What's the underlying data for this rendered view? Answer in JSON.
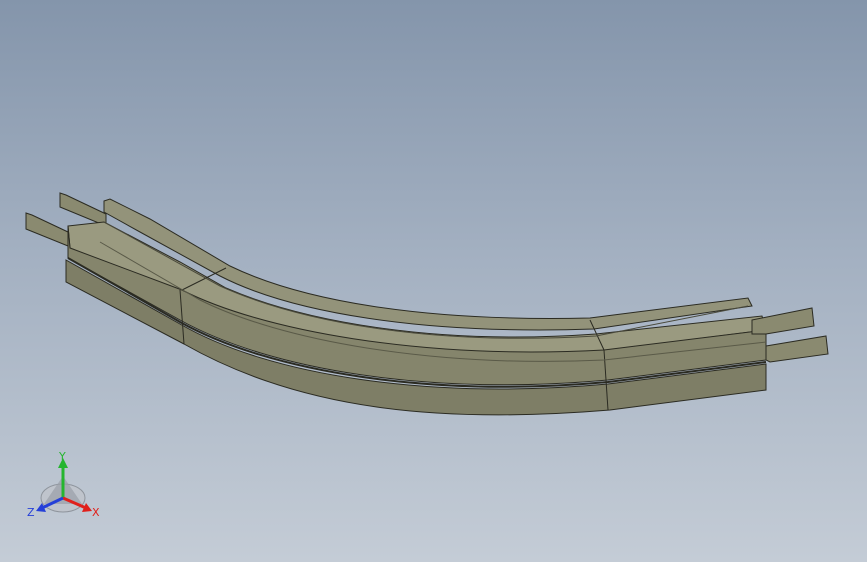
{
  "viewport": {
    "background_top": "#8495ab",
    "background_bottom": "#c4ccd6"
  },
  "model": {
    "description_color": "#8b8b72",
    "face_top": "#9a9a80",
    "face_front": "#85856c",
    "face_dark": "#6f6f5a",
    "edge": "#2b2b22"
  },
  "triad": {
    "x_label": "X",
    "y_label": "Y",
    "z_label": "Z",
    "x_color": "#e0201b",
    "y_color": "#25b52f",
    "z_color": "#2540d8"
  }
}
